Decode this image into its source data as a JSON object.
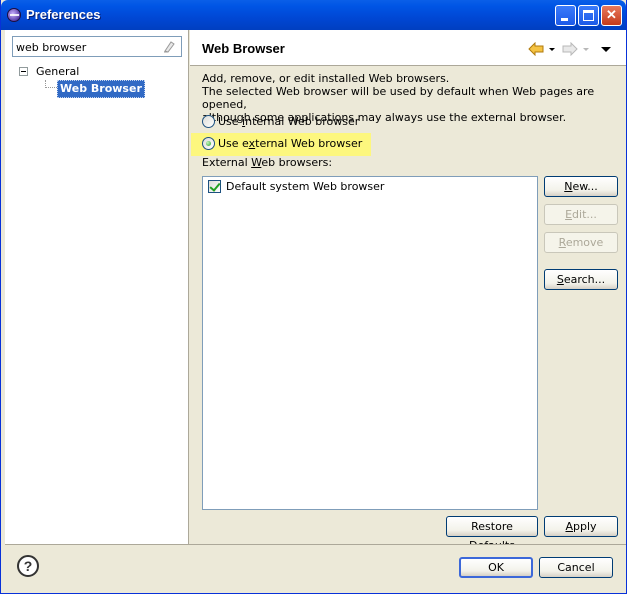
{
  "window": {
    "title": "Preferences",
    "minimize_icon": "minimize-icon",
    "maximize_icon": "maximize-icon",
    "close_glyph": "✕"
  },
  "sidebar": {
    "filter_value": "web browser",
    "tree": {
      "group_label": "General",
      "selected_label": "Web Browser"
    }
  },
  "page": {
    "title": "Web Browser",
    "description": [
      "Add, remove, or edit installed Web browsers.",
      "The selected Web browser will be used by default when Web pages are opened,",
      "although some applications may always use the external browser."
    ],
    "radio_internal": {
      "before": "Use ",
      "mnemonic": "i",
      "after": "nternal Web browser",
      "checked": false
    },
    "radio_external": {
      "before": "Use e",
      "mnemonic": "x",
      "after": "ternal Web browser",
      "checked": true
    },
    "external_label": {
      "before": "External ",
      "mnemonic": "W",
      "after": "eb browsers:"
    },
    "browsers": [
      {
        "name": "Default system Web browser",
        "checked": true
      }
    ],
    "buttons": {
      "new": {
        "mnemonic": "N",
        "after": "ew..."
      },
      "edit": {
        "mnemonic": "E",
        "after": "dit..."
      },
      "remove": {
        "mnemonic": "R",
        "after": "emove"
      },
      "search": {
        "mnemonic": "S",
        "after": "earch..."
      },
      "restore_defaults": {
        "before": "Restore ",
        "mnemonic": "D",
        "after": "efaults"
      },
      "apply": {
        "mnemonic": "A",
        "after": "pply"
      }
    }
  },
  "footer": {
    "ok_label": "OK",
    "cancel_label": "Cancel",
    "help_glyph": "?"
  },
  "colors": {
    "titlebar": "#0055e5",
    "selection": "#316ac5",
    "highlight": "#fdf77e",
    "nav_arrow": "#e8a21c"
  }
}
